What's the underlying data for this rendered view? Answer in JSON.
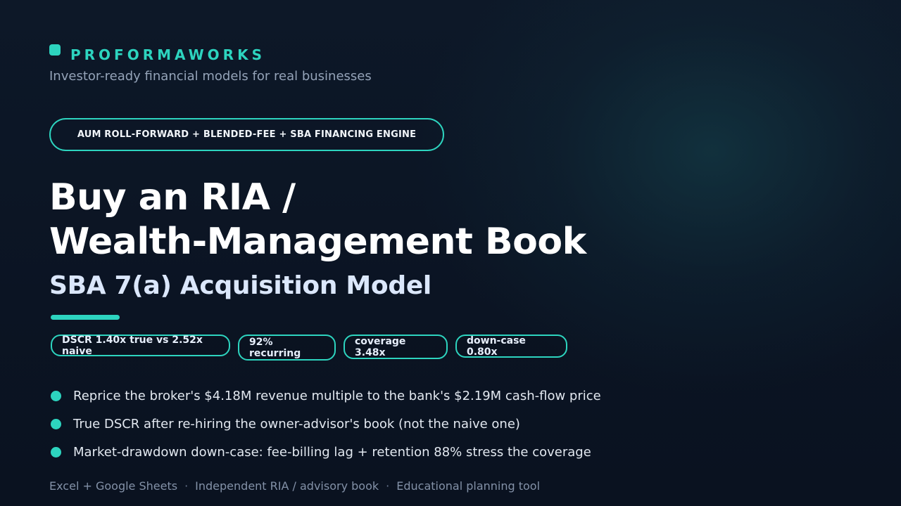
{
  "brand": {
    "name": "PROFORMAWORKS",
    "tagline": "Investor-ready financial models for real businesses",
    "accent_color": "#2dd4bf"
  },
  "engine_badge": "AUM ROLL-FORWARD + BLENDED-FEE + SBA FINANCING ENGINE",
  "hero": {
    "title_line1": "Buy an RIA /",
    "title_line2": "Wealth-Management Book",
    "subtitle": "SBA 7(a) Acquisition Model"
  },
  "chips": [
    {
      "label": "DSCR 1.40x true vs 2.52x naive"
    },
    {
      "label": "92% recurring"
    },
    {
      "label": "coverage 3.48x"
    },
    {
      "label": "down-case 0.80x"
    }
  ],
  "bullets": [
    {
      "text": "Reprice the broker's $4.18M revenue multiple to the bank's $2.19M cash-flow price"
    },
    {
      "text": "True DSCR after re-hiring the owner-advisor's book (not the naive one)"
    },
    {
      "text": "Market-drawdown down-case: fee-billing lag + retention 88% stress the coverage"
    }
  ],
  "footer": {
    "items": [
      "Excel + Google Sheets",
      "Independent RIA / advisory book",
      "Educational planning tool"
    ],
    "separator": "·"
  },
  "colors": {
    "background": "#0b1322",
    "accent": "#2dd4bf",
    "title": "#ffffff",
    "subtitle": "#dbe7fb",
    "muted": "#94a3b8"
  }
}
